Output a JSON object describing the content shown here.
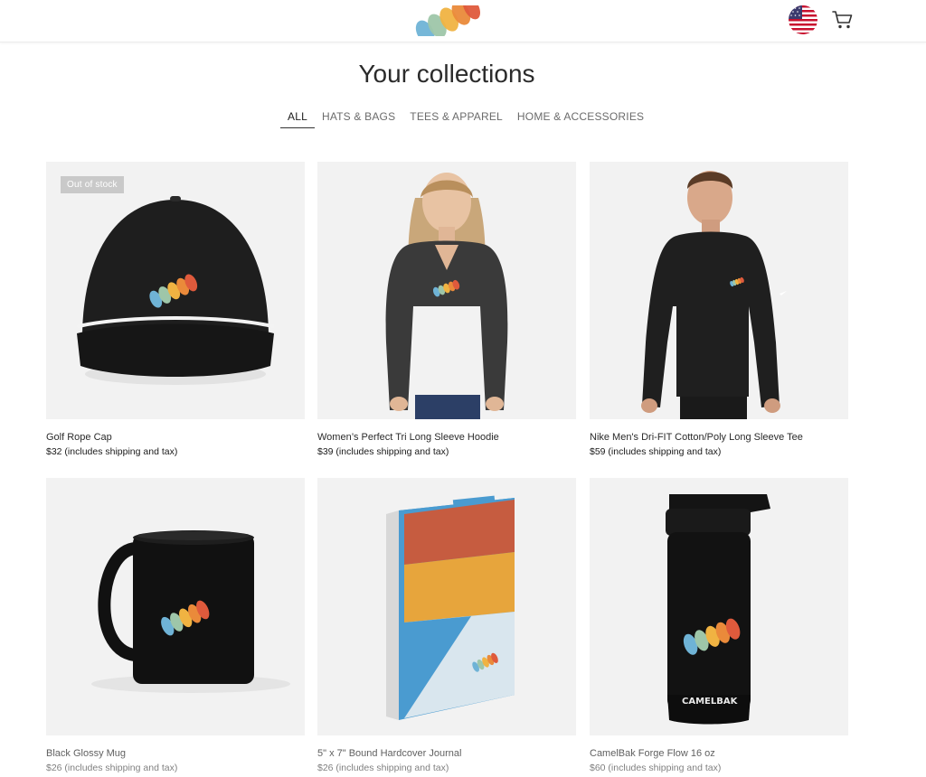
{
  "brand": {
    "logo_icon": "brushstroke-logo-icon"
  },
  "header": {
    "flag_icon": "us-flag-icon",
    "cart_icon": "shopping-cart-icon"
  },
  "page": {
    "title": "Your collections"
  },
  "tabs": [
    {
      "label": "ALL",
      "active": true
    },
    {
      "label": "HATS & BAGS",
      "active": false
    },
    {
      "label": "TEES & APPAREL",
      "active": false
    },
    {
      "label": "HOME & ACCESSORIES",
      "active": false
    }
  ],
  "products": [
    {
      "name": "Golf Rope Cap",
      "price": "$32 (includes shipping and tax)",
      "badge": "Out of stock"
    },
    {
      "name": "Women’s Perfect Tri Long Sleeve Hoodie",
      "price": "$39 (includes shipping and tax)"
    },
    {
      "name": "Nike Men's Dri-FIT Cotton/Poly Long Sleeve Tee",
      "price": "$59 (includes shipping and tax)"
    },
    {
      "name": "Black Glossy Mug",
      "price": "$26 (includes shipping and tax)"
    },
    {
      "name": "5\" x 7\" Bound Hardcover Journal",
      "price": "$26 (includes shipping and tax)"
    },
    {
      "name": "CamelBak Forge Flow 16 oz",
      "price": "$60 (includes shipping and tax)",
      "bottle_text": "CAMELBAK"
    }
  ],
  "colors": {
    "logo": [
      "#6fb3d6",
      "#9ec6a9",
      "#f0b342",
      "#ea8a3a",
      "#df5a3c"
    ],
    "tile_background": "#f2f2f2",
    "badge_background": "#c9c9c9"
  }
}
